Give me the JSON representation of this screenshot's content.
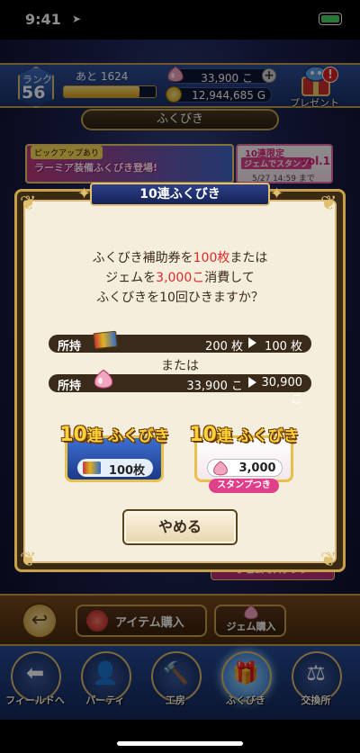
{
  "status_bar": {
    "time": "9:41",
    "location_arrow": "➤"
  },
  "header": {
    "rank_label": "ランク",
    "rank_value": "56",
    "exp_text": "あと 1624",
    "exp_progress": 0.82,
    "gems_value": "33,900 こ",
    "gold_value": "12,944,685 G",
    "present_label": "プレゼント",
    "present_badge": "!"
  },
  "section_title": "ふくびき",
  "banners": {
    "left_tag": "ピックアップあり",
    "left_text": "ラーミア装備ふくびき登場!",
    "right_line1": "10連限定",
    "right_line2": "ジェムでスタンプ",
    "right_vol": "vol.1",
    "right_date": "5/27 14:59 まで",
    "stamp_banner": "ジェムでスタンプ"
  },
  "dialog": {
    "title": "10連ふくびき",
    "message": {
      "line1_pre": "ふくびき補助券を",
      "line1_red": "100枚",
      "line1_post": "または",
      "line2_pre": "ジェムを",
      "line2_red": "3,000こ",
      "line2_post": "消費して",
      "line3": "ふくびきを10回ひきますか？"
    },
    "ticket_row": {
      "label": "所持",
      "from": "200 枚",
      "to": "100 枚"
    },
    "or_text": "または",
    "gem_row": {
      "label": "所持",
      "from": "33,900 こ",
      "to": "30,900 こ"
    },
    "ticket_button": {
      "head_num": "10",
      "head_text": "連 ふくびき",
      "cost": "100枚"
    },
    "gem_button": {
      "head_num": "10",
      "head_text": "連 ふくびき",
      "cost": "3,000こ",
      "ribbon": "スタンプつき"
    },
    "cancel_label": "やめる"
  },
  "toolbar": {
    "back_icon": "↩",
    "item_purchase_label": "アイテム購入",
    "gem_purchase_label": "ジェム購入"
  },
  "bottom_nav": [
    {
      "label": "フィールドへ",
      "icon": "field-icon",
      "glyph": "⬅"
    },
    {
      "label": "パーティ",
      "icon": "party-icon",
      "glyph": "👤"
    },
    {
      "label": "工房",
      "icon": "workshop-icon",
      "glyph": "🔨"
    },
    {
      "label": "ふくびき",
      "icon": "lottery-icon",
      "glyph": "🎁",
      "active": true
    },
    {
      "label": "交換所",
      "icon": "exchange-icon",
      "glyph": "⚖"
    }
  ],
  "colors": {
    "accent_gold": "#c9a04a",
    "highlight_red": "#e02828",
    "stamp_pink": "#e0408a",
    "dialog_cream": "#f6eedd",
    "header_blue": "#2e4f98"
  }
}
